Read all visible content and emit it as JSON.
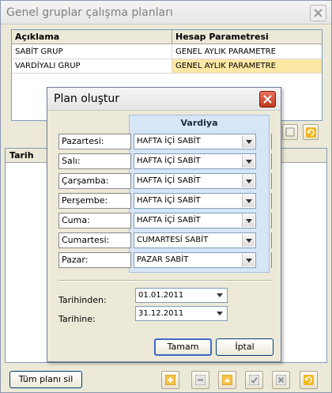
{
  "window": {
    "title": "Genel gruplar çalışma planları"
  },
  "top_grid": {
    "headers": [
      "Açıklama",
      "Hesap Parametresi"
    ],
    "rows": [
      [
        "SABİT GRUP",
        "GENEL AYLIK PARAMETRE"
      ],
      [
        "VARDİYALI GRUP",
        "GENEL AYLIK PARAMETRE"
      ]
    ]
  },
  "bottom_grid": {
    "header": "Tarih"
  },
  "bottom_toolbar": {
    "delete_all_label": "Tüm planı sil"
  },
  "dialog": {
    "title": "Plan oluştur",
    "vardiya_header": "Vardiya",
    "days": [
      {
        "label": "Pazartesi:",
        "value": "HAFTA İÇİ SABİT"
      },
      {
        "label": "Salı:",
        "value": "HAFTA İÇİ SABİT"
      },
      {
        "label": "Çarşamba:",
        "value": "HAFTA İÇİ SABİT"
      },
      {
        "label": "Perşembe:",
        "value": "HAFTA İÇİ SABİT"
      },
      {
        "label": "Cuma:",
        "value": "HAFTA İÇİ SABİT"
      },
      {
        "label": "Cumartesi:",
        "value": "CUMARTESİ SABİT"
      },
      {
        "label": "Pazar:",
        "value": "PAZAR SABİT"
      }
    ],
    "from_label": "Tarihinden:",
    "from_value": "01.01.2011",
    "to_label": "Tarihine:",
    "to_value": "31.12.2011",
    "ok_label": "Tamam",
    "cancel_label": "İptal"
  },
  "colors": {
    "highlight": "#fde8a6",
    "panel": "#d6e6f7",
    "close": "#c1391f"
  }
}
